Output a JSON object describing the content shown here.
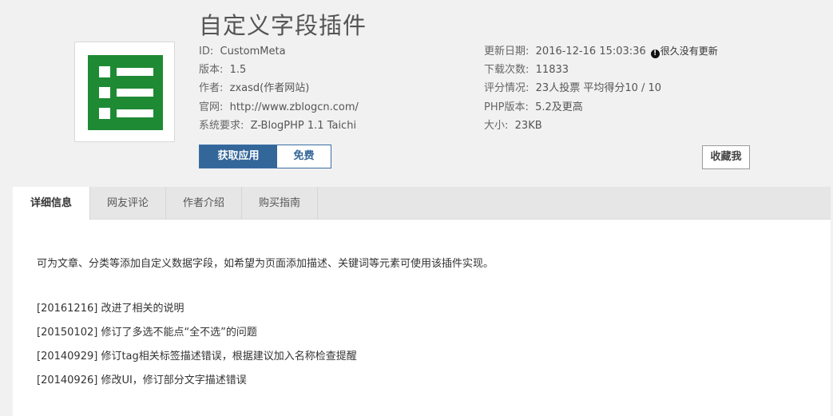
{
  "plugin": {
    "title": "自定义字段插件",
    "logo_icon": "list-icon",
    "accent_color": "#336699",
    "logo_color": "#1e8a34"
  },
  "meta_left": [
    {
      "label": "ID:",
      "value": "CustomMeta"
    },
    {
      "label": "版本:",
      "value": "1.5"
    },
    {
      "label": "作者:",
      "value": "zxasd(作者网站)"
    },
    {
      "label": "官网:",
      "value": "http://www.zblogcn.com/"
    },
    {
      "label": "系统要求:",
      "value": "Z-BlogPHP 1.1 Taichi"
    }
  ],
  "meta_right": [
    {
      "label": "更新日期:",
      "value": "2016-12-16 15:03:36",
      "note": "很久没有更新"
    },
    {
      "label": "下载次数:",
      "value": "11833"
    },
    {
      "label": "评分情况:",
      "value": "23人投票 平均得分10 / 10"
    },
    {
      "label": "PHP版本:",
      "value": "5.2及更高"
    },
    {
      "label": "大小:",
      "value": "23KB"
    }
  ],
  "buttons": {
    "get_label": "获取应用",
    "price_label": "免费",
    "favorite_label": "收藏我"
  },
  "tabs": [
    {
      "label": "详细信息",
      "active": true
    },
    {
      "label": "网友评论",
      "active": false
    },
    {
      "label": "作者介绍",
      "active": false
    },
    {
      "label": "购买指南",
      "active": false
    }
  ],
  "content": {
    "description": "可为文章、分类等添加自定义数据字段，如希望为页面添加描述、关键词等元素可使用该插件实现。",
    "changelog": [
      "[20161216] 改进了相关的说明",
      "[20150102] 修订了多选不能点“全不选”的问题",
      "[20140929] 修订tag相关标签描述错误，根据建议加入名称检查提醒",
      "[20140926] 修改UI，修订部分文字描述错误"
    ]
  }
}
